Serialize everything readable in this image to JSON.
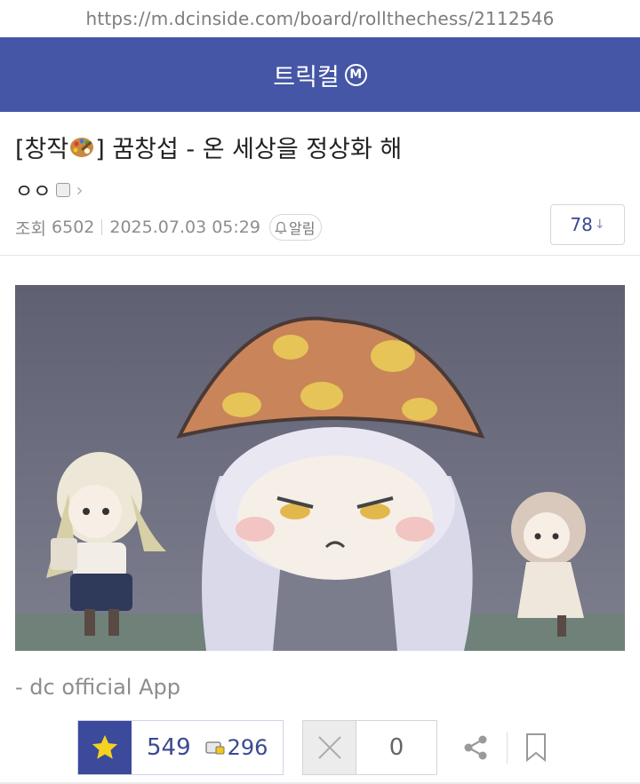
{
  "browser": {
    "url": "https://m.dcinside.com/board/rollthechess/2112546"
  },
  "gallery": {
    "name": "트릭컬",
    "badge": "M"
  },
  "post": {
    "title_prefix": "[창작",
    "title_rest": "] 꿈창섭 - 온 세상을 정상화 해",
    "author": "ㅇㅇ",
    "views_label": "조회",
    "views": "6502",
    "datetime": "2025.07.03 05:29",
    "alarm_label": "알림",
    "comment_count": "78",
    "comment_arrow": "↓",
    "source_text": "- dc official App"
  },
  "votes": {
    "upvotes": "549",
    "fixed_upvotes": "296",
    "downvotes": "0"
  },
  "colors": {
    "brand": "#4556a6",
    "accent": "#3b4a9a",
    "star": "#f5d21f"
  },
  "icons": [
    "palette-emoji",
    "fixed-nick-icon",
    "chevron-right-icon",
    "bell-icon",
    "star-icon",
    "fixed-icon",
    "x-icon",
    "share-icon",
    "bookmark-icon"
  ]
}
